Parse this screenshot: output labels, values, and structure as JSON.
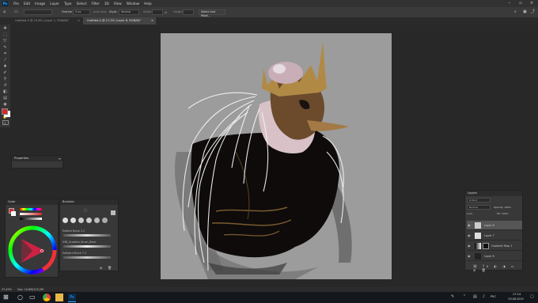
{
  "menu": [
    "File",
    "Edit",
    "Image",
    "Layer",
    "Type",
    "Select",
    "Filter",
    "3D",
    "View",
    "Window",
    "Help"
  ],
  "options": {
    "feather_label": "Feather:",
    "feather_value": "0 px",
    "antialias_label": "Anti-alias",
    "style_label": "Style:",
    "style_value": "Normal",
    "width_label": "Width:",
    "height_label": "Height:",
    "select_mask": "Select and Mask..."
  },
  "tabs": [
    {
      "label": "Untitled-3 @ 29,6% (Layer 1, RGB/8)*",
      "close": "×"
    },
    {
      "label": "Untitled-4 @ 27,5% (Layer 8, RGB/8)*",
      "close": "×"
    }
  ],
  "properties": {
    "title": "Properties"
  },
  "color_panel": {
    "title": "Color"
  },
  "brushes_panel": {
    "title": "Brushes",
    "items": [
      "Eattbrd Brush 2-2",
      "KSB_Gradient_Brush_Basic",
      "Eattybrd Brush 7-3"
    ]
  },
  "layers": {
    "title": "Layers",
    "kind": "Q Kind",
    "mode": "Normal",
    "opacity": "Opacity: 100%",
    "fill": "Fill: 100%",
    "lock": "Lock:",
    "items": [
      "Layer 8",
      "Layer 7",
      "Gradient Map 1",
      "Layer 6"
    ]
  },
  "status": {
    "zoom": "27,45%",
    "doc": "Doc: 10,6M/125,2M"
  },
  "taskbar": {
    "lang": "РУС",
    "time": "17:14",
    "date": "29.08.2019"
  },
  "colors": {
    "fg": "#d12a2a",
    "bg": "#ffffff",
    "accent": "#31a8ff"
  }
}
